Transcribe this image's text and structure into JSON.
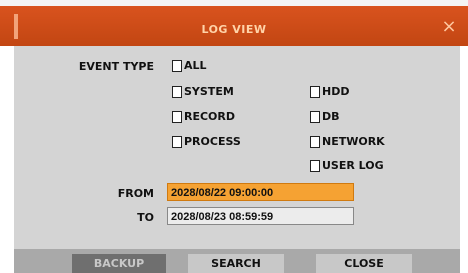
{
  "dialog": {
    "title": "LOG VIEW",
    "close_glyph": "×"
  },
  "event_type": {
    "label": "EVENT TYPE",
    "options": {
      "all": "ALL",
      "system": "SYSTEM",
      "record": "RECORD",
      "process": "PROCESS",
      "hdd": "HDD",
      "db": "DB",
      "network": "NETWORK",
      "user_log": "USER LOG"
    }
  },
  "range": {
    "from_label": "FROM",
    "from_value": "2028/08/22 09:00:00",
    "to_label": "TO",
    "to_value": "2028/08/23 08:59:59"
  },
  "buttons": {
    "backup": "BACKUP",
    "search": "SEARCH",
    "close": "CLOSE"
  },
  "colors": {
    "title_bar": "#c94a16",
    "from_field_highlight": "#f5a233",
    "panel": "#d4d4d4"
  }
}
